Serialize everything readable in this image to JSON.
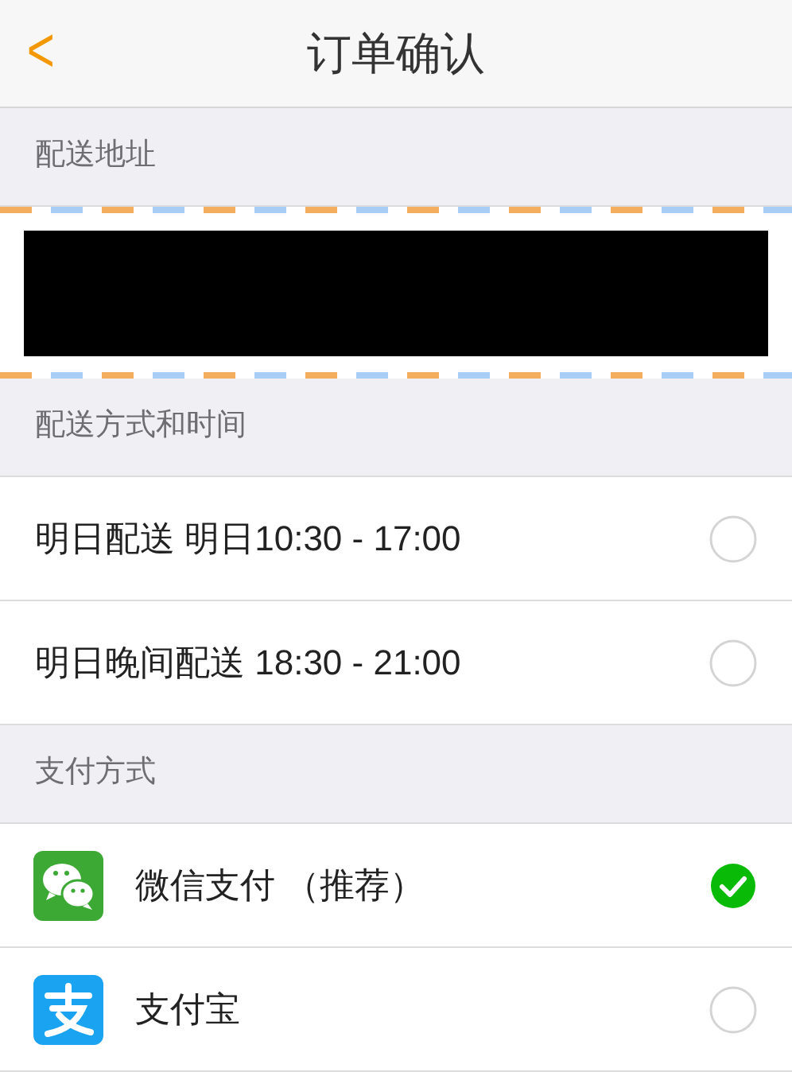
{
  "header": {
    "back": "<",
    "title": "订单确认"
  },
  "address_section": {
    "heading": "配送地址",
    "address": {
      "kind": "redacted"
    }
  },
  "delivery_section": {
    "heading": "配送方式和时间",
    "options": [
      {
        "label": "明日配送 明日10:30 - 17:00",
        "selected": false
      },
      {
        "label": "明日晚间配送 18:30 - 21:00",
        "selected": false
      }
    ]
  },
  "payment_section": {
    "heading": "支付方式",
    "options": [
      {
        "label": "微信支付 （推荐）",
        "kind": "wechat",
        "selected": true
      },
      {
        "label": "支付宝",
        "kind": "alipay",
        "selected": false
      }
    ]
  }
}
